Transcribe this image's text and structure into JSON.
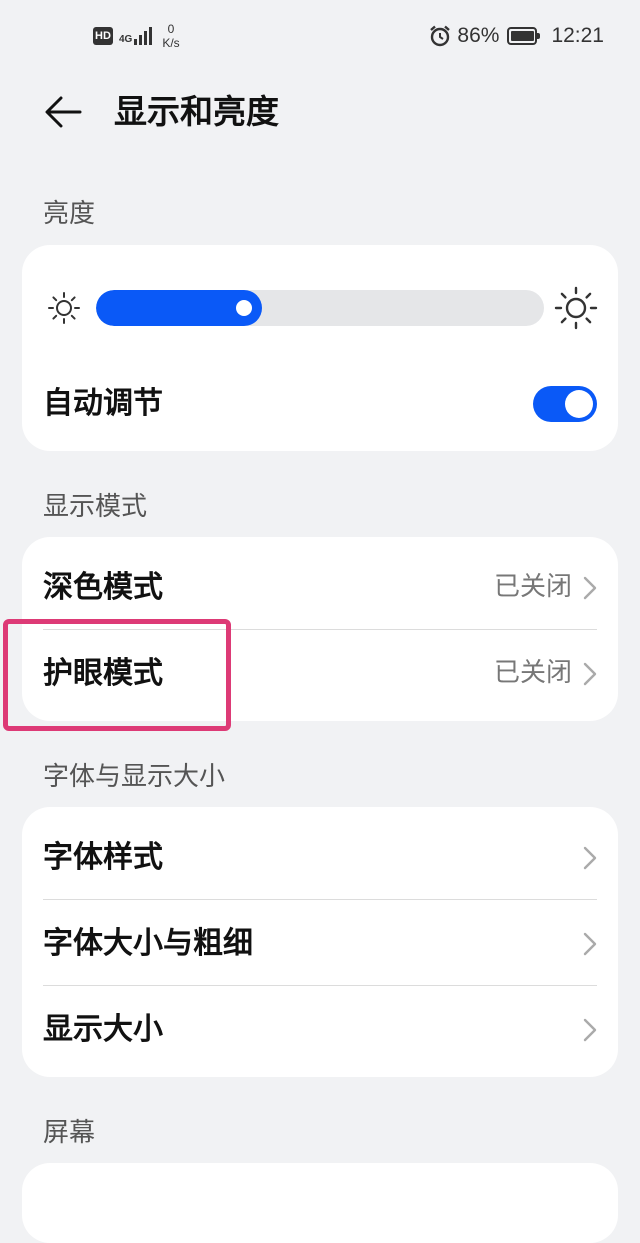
{
  "status_bar": {
    "hd": "HD",
    "network": "4G",
    "speed_value": "0",
    "speed_unit": "K/s",
    "battery": "86%",
    "time": "12:21"
  },
  "header": {
    "title": "显示和亮度"
  },
  "brightness": {
    "section_label": "亮度",
    "level_percent": 37,
    "auto_label": "自动调节",
    "auto_enabled": true
  },
  "display_mode": {
    "section_label": "显示模式",
    "items": [
      {
        "label": "深色模式",
        "value": "已关闭"
      },
      {
        "label": "护眼模式",
        "value": "已关闭"
      }
    ]
  },
  "font_display": {
    "section_label": "字体与显示大小",
    "items": [
      {
        "label": "字体样式"
      },
      {
        "label": "字体大小与粗细"
      },
      {
        "label": "显示大小"
      }
    ]
  },
  "screen": {
    "section_label": "屏幕"
  },
  "colors": {
    "accent": "#0a59f7",
    "highlight": "#dd3a76"
  },
  "icons": [
    "back-arrow-icon",
    "sun-small-icon",
    "sun-large-icon",
    "chevron-right-icon",
    "alarm-icon",
    "battery-icon"
  ]
}
